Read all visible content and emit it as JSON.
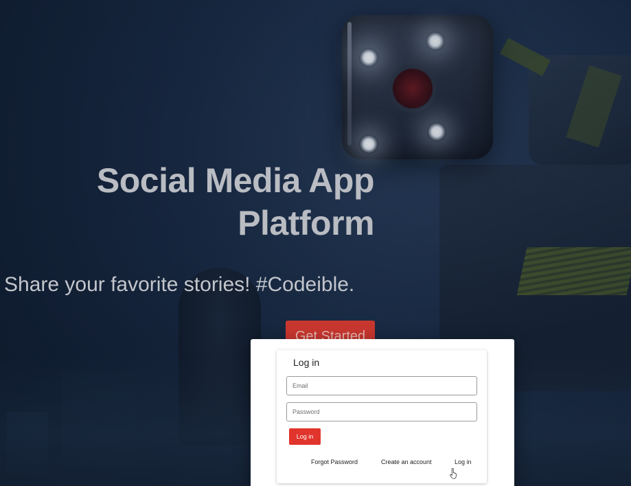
{
  "hero": {
    "title_line1": "Social Media App",
    "title_line2": "Platform",
    "subtitle": "Share your favorite stories! #Codeible.",
    "cta_label": "Get Started"
  },
  "login_modal": {
    "title": "Log in",
    "email_placeholder": "Email",
    "password_placeholder": "Password",
    "submit_label": "Log in",
    "links": {
      "forgot_password": "Forgot Password",
      "create_account": "Create an account",
      "log_in": "Log in"
    }
  },
  "colors": {
    "cta_bg": "#c8372f",
    "submit_bg": "#e1342c",
    "hero_text": "#b9bcc2",
    "background": "#1b2d48"
  },
  "icons": {
    "cursor": "hand-pointer-icon"
  }
}
